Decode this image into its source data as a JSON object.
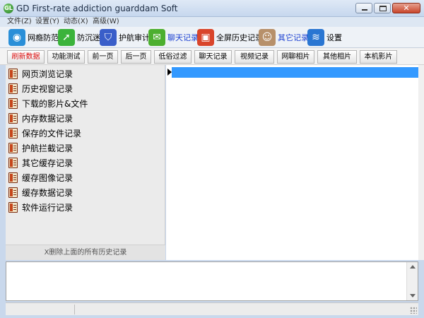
{
  "window": {
    "title": "GD First-rate addiction guarddam Soft",
    "app_icon_text": "GL",
    "close_glyph": "✕"
  },
  "menu": [
    {
      "label": "文件(Z)"
    },
    {
      "label": "设置(Y)"
    },
    {
      "label": "动态(X)"
    },
    {
      "label": "高级(W)"
    }
  ],
  "toolbar": [
    {
      "label": "网瘾防范",
      "icon": "globe-shield-icon",
      "color": "#2a8fd8",
      "glyph": "◉"
    },
    {
      "label": "防沉迷",
      "icon": "green-arrow-icon",
      "color": "#3bb33b",
      "glyph": "➚"
    },
    {
      "label": "护航审计",
      "icon": "audit-shield-icon",
      "color": "#3a5ec9",
      "glyph": "⛉"
    },
    {
      "label": "聊天记录",
      "icon": "chat-bubble-icon",
      "color": "#4caf2f",
      "glyph": "✉"
    },
    {
      "label": "全屏历史记录",
      "icon": "screen-history-icon",
      "color": "#d9452b",
      "glyph": "▣"
    },
    {
      "label": "其它记录",
      "icon": "user-photo-icon",
      "color": "#b7906a",
      "glyph": "☺"
    },
    {
      "label": "设置",
      "icon": "wifi-icon",
      "color": "#2a76d2",
      "glyph": "≋"
    }
  ],
  "subtoolbar": [
    {
      "label": "刷新数据",
      "accent": "red"
    },
    {
      "label": "功能测试"
    },
    {
      "label": "前一页"
    },
    {
      "label": "后一页"
    },
    {
      "label": "低俗过滤"
    },
    {
      "label": "聊天记录"
    },
    {
      "label": "视频记录"
    },
    {
      "label": "网聊相片"
    },
    {
      "label": "其他相片"
    },
    {
      "label": "本机影片"
    }
  ],
  "tree": [
    {
      "label": "网页浏览记录"
    },
    {
      "label": "历史视窗记录"
    },
    {
      "label": "下载的影片&文件"
    },
    {
      "label": "内存数据记录"
    },
    {
      "label": "保存的文件记录"
    },
    {
      "label": "护航拦截记录"
    },
    {
      "label": "其它缓存记录"
    },
    {
      "label": "缓存图像记录"
    },
    {
      "label": "缓存数据记录"
    },
    {
      "label": "软件运行记录"
    }
  ],
  "left_footer": "X删除上面的所有历史记录",
  "colors": {
    "selection": "#3399ff",
    "title_bar": "#c6d7ee",
    "accent_red": "#dd1111",
    "accent_blue": "#1a3fd1"
  }
}
